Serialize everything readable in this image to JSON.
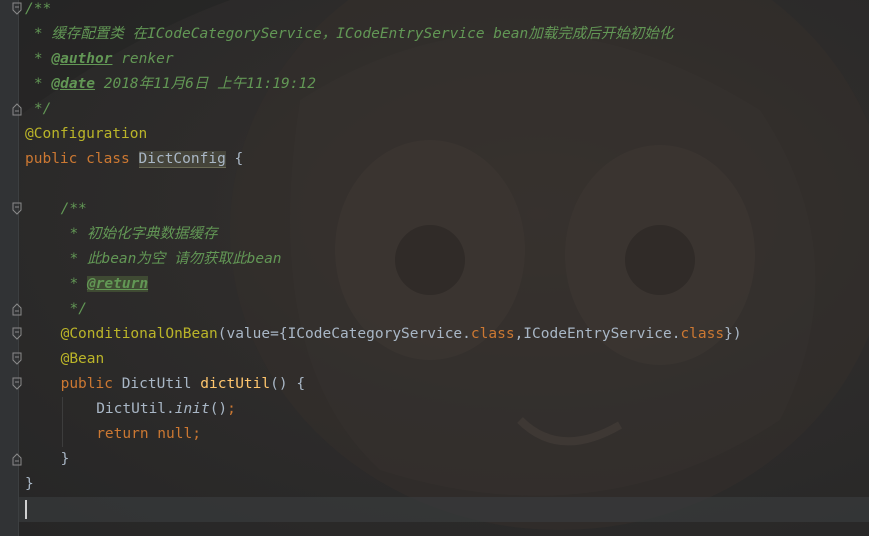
{
  "editor": {
    "lines": [
      {
        "indent": 0,
        "tokens": [
          {
            "cls": "c-comment",
            "text": "/**"
          }
        ]
      },
      {
        "indent": 1,
        "tokens": [
          {
            "cls": "c-comment",
            "text": "* 缓存配置类 在ICodeCategoryService，ICodeEntryService bean加载完成后开始初始化"
          }
        ]
      },
      {
        "indent": 1,
        "tokens": [
          {
            "cls": "c-comment",
            "text": "* "
          },
          {
            "cls": "c-tag",
            "text": "@author"
          },
          {
            "cls": "c-comment",
            "text": " renker"
          }
        ]
      },
      {
        "indent": 1,
        "tokens": [
          {
            "cls": "c-comment",
            "text": "* "
          },
          {
            "cls": "c-tag",
            "text": "@date"
          },
          {
            "cls": "c-comment",
            "text": " 2018年11月6日 上午11:19:12"
          }
        ]
      },
      {
        "indent": 1,
        "tokens": [
          {
            "cls": "c-comment",
            "text": "*/"
          }
        ]
      },
      {
        "indent": 0,
        "tokens": [
          {
            "cls": "c-annot",
            "text": "@Configuration"
          }
        ]
      },
      {
        "indent": 0,
        "tokens": [
          {
            "cls": "c-kw",
            "text": "public class "
          },
          {
            "cls": "c-text c-class-hl",
            "text": "DictConfig"
          },
          {
            "cls": "c-text",
            "text": " {"
          }
        ]
      },
      {
        "indent": 0,
        "tokens": []
      },
      {
        "indent": 4,
        "tokens": [
          {
            "cls": "c-comment",
            "text": "/**"
          }
        ]
      },
      {
        "indent": 5,
        "tokens": [
          {
            "cls": "c-comment",
            "text": "* 初始化字典数据缓存"
          }
        ]
      },
      {
        "indent": 5,
        "tokens": [
          {
            "cls": "c-comment",
            "text": "* 此bean为空 请勿获取此bean"
          }
        ]
      },
      {
        "indent": 5,
        "tokens": [
          {
            "cls": "c-comment",
            "text": "* "
          },
          {
            "cls": "c-tag c-tag-hl",
            "text": "@return"
          }
        ]
      },
      {
        "indent": 5,
        "tokens": [
          {
            "cls": "c-comment",
            "text": "*/"
          }
        ]
      },
      {
        "indent": 4,
        "tokens": [
          {
            "cls": "c-annot",
            "text": "@ConditionalOnBean"
          },
          {
            "cls": "c-text",
            "text": "(value={ICodeCategoryService."
          },
          {
            "cls": "c-kw",
            "text": "class"
          },
          {
            "cls": "c-text",
            "text": ",ICodeEntryService."
          },
          {
            "cls": "c-kw",
            "text": "class"
          },
          {
            "cls": "c-text",
            "text": "})"
          }
        ]
      },
      {
        "indent": 4,
        "tokens": [
          {
            "cls": "c-annot",
            "text": "@Bean"
          }
        ]
      },
      {
        "indent": 4,
        "tokens": [
          {
            "cls": "c-kw",
            "text": "public "
          },
          {
            "cls": "c-text",
            "text": "DictUtil "
          },
          {
            "cls": "c-method",
            "text": "dictUtil"
          },
          {
            "cls": "c-text",
            "text": "() {"
          }
        ]
      },
      {
        "indent": 8,
        "tokens": [
          {
            "cls": "c-text",
            "text": "DictUtil."
          },
          {
            "cls": "c-static",
            "text": "init"
          },
          {
            "cls": "c-text",
            "text": "()"
          },
          {
            "cls": "c-kw",
            "text": ";"
          }
        ]
      },
      {
        "indent": 8,
        "tokens": [
          {
            "cls": "c-kw",
            "text": "return null;"
          }
        ]
      },
      {
        "indent": 4,
        "tokens": [
          {
            "cls": "c-text",
            "text": "}"
          }
        ]
      },
      {
        "indent": 0,
        "tokens": [
          {
            "cls": "c-text",
            "text": "}"
          }
        ]
      },
      {
        "indent": 0,
        "tokens": []
      }
    ]
  }
}
